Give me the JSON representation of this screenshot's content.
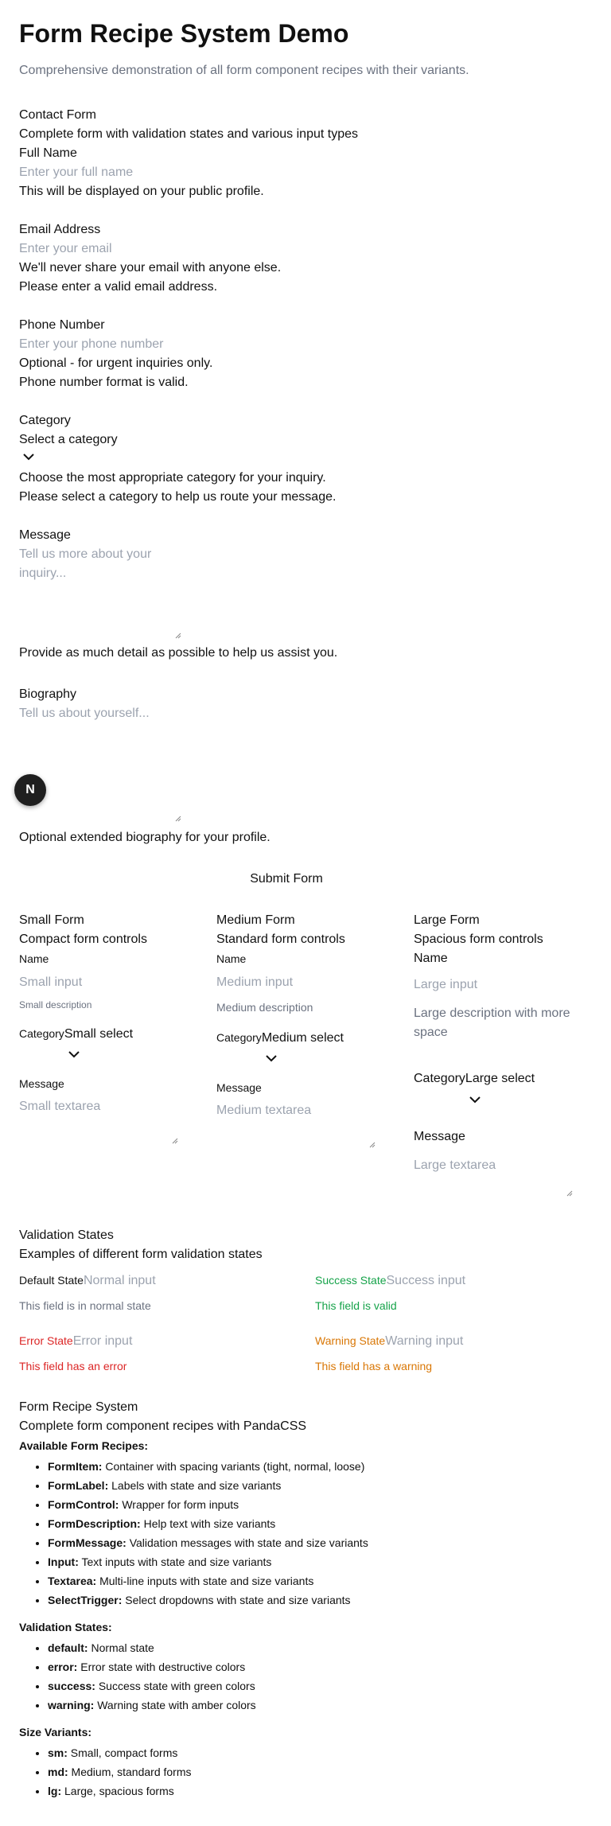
{
  "page": {
    "title": "Form Recipe System Demo",
    "subtitle": "Comprehensive demonstration of all form component recipes with their variants."
  },
  "contact": {
    "title": "Contact Form",
    "description": "Complete form with validation states and various input types",
    "full_name": {
      "label": "Full Name",
      "placeholder": "Enter your full name",
      "help": "This will be displayed on your public profile."
    },
    "email": {
      "label": "Email Address",
      "placeholder": "Enter your email",
      "help": "We'll never share your email with anyone else.",
      "message": "Please enter a valid email address."
    },
    "phone": {
      "label": "Phone Number",
      "placeholder": "Enter your phone number",
      "help": "Optional - for urgent inquiries only.",
      "message": "Phone number format is valid."
    },
    "category": {
      "label": "Category",
      "value": "Select a category",
      "help": "Choose the most appropriate category for your inquiry.",
      "message": "Please select a category to help us route your message."
    },
    "message": {
      "label": "Message",
      "placeholder_line1": "Tell us more about your",
      "placeholder_line2": "inquiry...",
      "help": "Provide as much detail as possible to help us assist you."
    },
    "biography": {
      "label": "Biography",
      "placeholder": "Tell us about yourself...",
      "help": "Optional extended biography for your profile."
    },
    "submit_label": "Submit Form"
  },
  "fab": {
    "label": "N"
  },
  "sizes": {
    "small": {
      "title": "Small Form",
      "description": "Compact form controls",
      "name_label": "Name",
      "input_placeholder": "Small input",
      "help": "Small description",
      "category_label": "Category",
      "select_value": "Small select",
      "message_label": "Message",
      "textarea_placeholder": "Small textarea"
    },
    "medium": {
      "title": "Medium Form",
      "description": "Standard form controls",
      "name_label": "Name",
      "input_placeholder": "Medium input",
      "help": "Medium description",
      "category_label": "Category",
      "select_value": "Medium select",
      "message_label": "Message",
      "textarea_placeholder": "Medium textarea"
    },
    "large": {
      "title": "Large Form",
      "description": "Spacious form controls",
      "name_label": "Name",
      "input_placeholder": "Large input",
      "help_line1": "Large description with more",
      "help_line2": "space",
      "category_label": "Category",
      "select_value": "Large select",
      "message_label": "Message",
      "textarea_placeholder": "Large textarea"
    }
  },
  "validation": {
    "title": "Validation States",
    "description": "Examples of different form validation states",
    "default": {
      "label": "Default State",
      "placeholder": "Normal input",
      "message": "This field is in normal state"
    },
    "success": {
      "label": "Success State",
      "placeholder": "Success input",
      "message": "This field is valid"
    },
    "error": {
      "label": "Error State",
      "placeholder": "Error input",
      "message": "This field has an error"
    },
    "warning": {
      "label": "Warning State",
      "placeholder": "Warning input",
      "message": "This field has a warning"
    }
  },
  "recipes": {
    "title": "Form Recipe System",
    "description": "Complete form component recipes with PandaCSS",
    "available_heading": "Available Form Recipes:",
    "available": [
      {
        "name": "FormItem:",
        "text": " Container with spacing variants (tight, normal, loose)"
      },
      {
        "name": "FormLabel:",
        "text": " Labels with state and size variants"
      },
      {
        "name": "FormControl:",
        "text": " Wrapper for form inputs"
      },
      {
        "name": "FormDescription:",
        "text": " Help text with size variants"
      },
      {
        "name": "FormMessage:",
        "text": " Validation messages with state and size variants"
      },
      {
        "name": "Input:",
        "text": " Text inputs with state and size variants"
      },
      {
        "name": "Textarea:",
        "text": " Multi-line inputs with state and size variants"
      },
      {
        "name": "SelectTrigger:",
        "text": " Select dropdowns with state and size variants"
      }
    ],
    "states_heading": "Validation States:",
    "states": [
      {
        "name": "default:",
        "text": " Normal state"
      },
      {
        "name": "error:",
        "text": " Error state with destructive colors"
      },
      {
        "name": "success:",
        "text": " Success state with green colors"
      },
      {
        "name": "warning:",
        "text": " Warning state with amber colors"
      }
    ],
    "sizes_heading": "Size Variants:",
    "sizes": [
      {
        "name": "sm:",
        "text": " Small, compact forms"
      },
      {
        "name": "md:",
        "text": " Medium, standard forms"
      },
      {
        "name": "lg:",
        "text": " Large, spacious forms"
      }
    ]
  },
  "colors": {
    "success": "#16a34a",
    "error": "#dc2626",
    "warning": "#d97706",
    "muted": "#6b7280",
    "placeholder": "#9ca3af"
  }
}
